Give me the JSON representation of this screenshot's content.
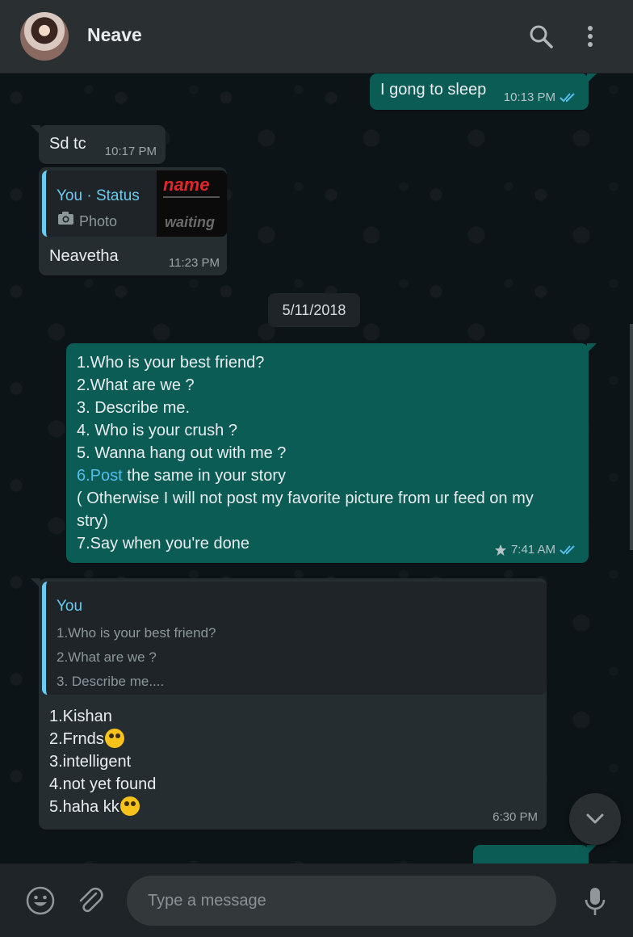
{
  "header": {
    "contact_name": "Neave",
    "icons": [
      "avatar",
      "search-icon",
      "menu-icon"
    ]
  },
  "messages": {
    "m1": {
      "text": "I gong to sleep",
      "time": "10:13 PM",
      "status": "read"
    },
    "m2": {
      "text": "Sd tc",
      "time": "10:17 PM"
    },
    "m3": {
      "quote_author": "You · Status",
      "quote_type": "Photo",
      "thumb_title": "name",
      "thumb_caption": "waiting",
      "text": "Neavetha",
      "time": "11:23 PM"
    },
    "date_separator": "5/11/2018",
    "m4": {
      "lines": [
        "1.Who is your best friend?",
        "2.What are we ?",
        "3. Describe me.",
        "4. Who is your crush ?",
        "5. Wanna hang out with me ?",
        "6.Post",
        " the same in your story",
        "( Otherwise I will not post my favorite picture from ur feed on my",
        "stry)",
        "7.Say when you're done"
      ],
      "time": "7:41 AM",
      "starred": true,
      "status": "read"
    },
    "m5": {
      "quote_author": "You",
      "quote_lines": [
        "1.Who is your best friend?",
        "2.What are we ?",
        "3. Describe me...."
      ],
      "lines": [
        "1.Kishan",
        "2.Frnds",
        "3.intelligent",
        "4.not yet found",
        "5.haha kk"
      ],
      "time": "6:30 PM"
    }
  },
  "composer": {
    "placeholder": "Type a message",
    "icons": [
      "emoji-icon",
      "attach-icon",
      "mic-icon"
    ]
  },
  "colors": {
    "outgoing_bubble": "#0a5c55",
    "incoming_bubble": "#262d31",
    "read_ticks": "#53bdeb",
    "quote_accent": "#6bcbef"
  }
}
